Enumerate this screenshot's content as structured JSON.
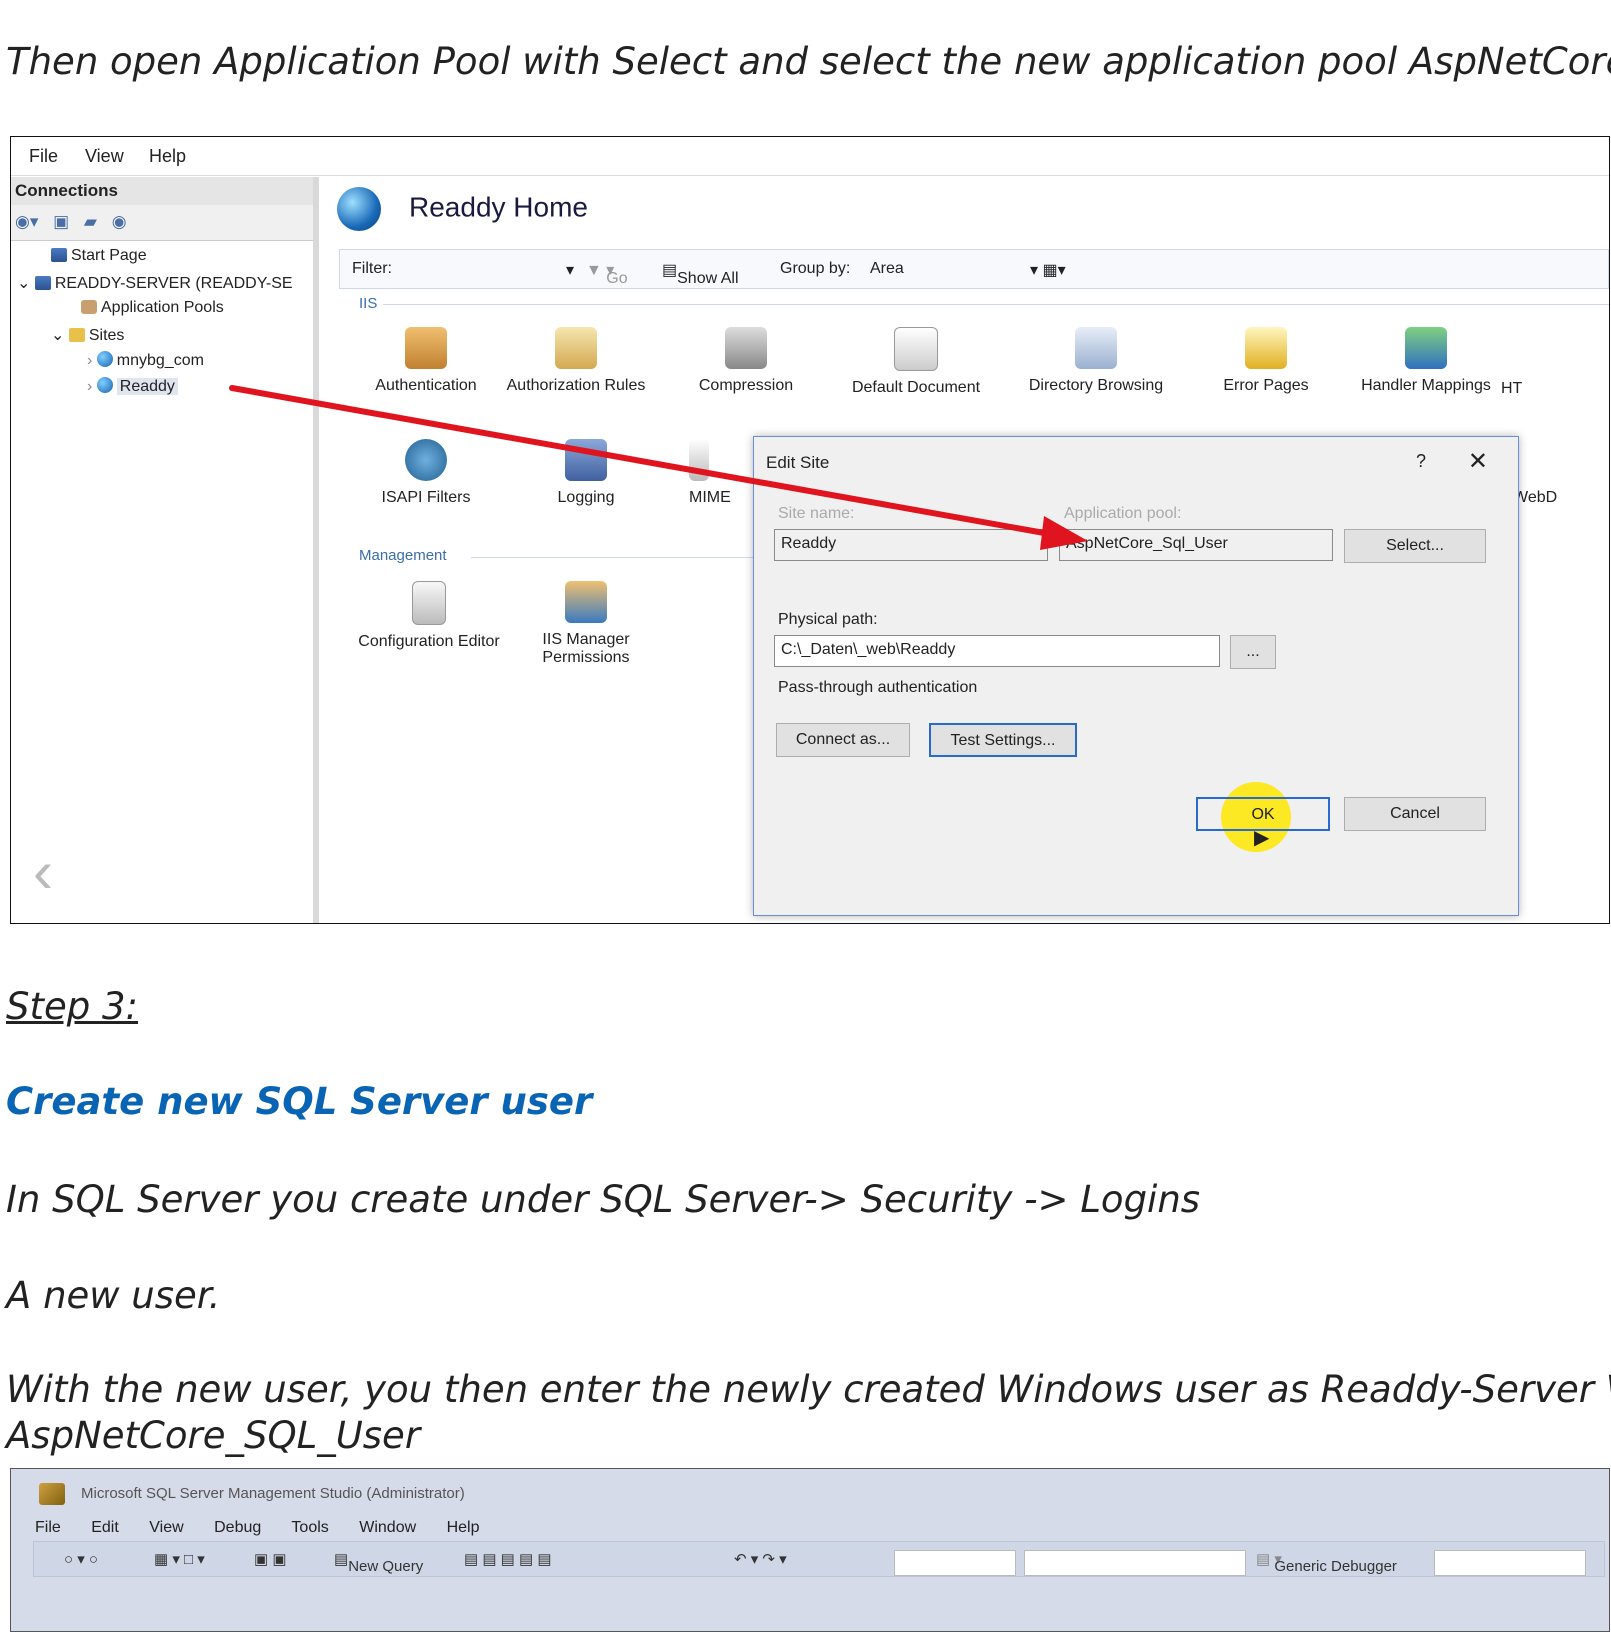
{
  "doc": {
    "intro": "Then open Application Pool with Select and select the new application pool AspNetCore_",
    "step": "Step 3:",
    "heading": "Create new SQL Server user",
    "p1": "In SQL Server you create under SQL Server-> Security -> Logins",
    "p2": "A new user.",
    "p3a": "With the new user, you then enter the newly created Windows user as Readdy-Server \\",
    "p3b": "AspNetCore_SQL_User"
  },
  "iis": {
    "menu": [
      "File",
      "View",
      "Help"
    ],
    "connections": {
      "title": "Connections",
      "tree": {
        "start_page": "Start Page",
        "server": "READDY-SERVER (READDY-SE",
        "app_pools": "Application Pools",
        "sites": "Sites",
        "site1": "mnybg_com",
        "site2": "Readdy"
      }
    },
    "main": {
      "title": "Readdy Home",
      "filter_label": "Filter:",
      "go": "Go",
      "show_all": "Show All",
      "group_by": "Group by:",
      "group_value": "Area",
      "group_iis": "IIS",
      "group_management": "Management",
      "features_iis": [
        "Authentication",
        "Authorization Rules",
        "Compression",
        "Default Document",
        "Directory Browsing",
        "Error Pages",
        "Handler Mappings",
        "HT"
      ],
      "features_iis2": [
        "ISAPI Filters",
        "Logging",
        "MIME"
      ],
      "feature_webd": "WebD",
      "features_mgmt": [
        "Configuration Editor",
        "IIS Manager Permissions"
      ]
    },
    "dialog": {
      "title": "Edit Site",
      "help": "?",
      "close": "✕",
      "site_name_label": "Site name:",
      "site_name_value": "Readdy",
      "app_pool_label": "Application pool:",
      "app_pool_value": "AspNetCore_Sql_User",
      "select_button": "Select...",
      "physical_path_label": "Physical path:",
      "physical_path_value": "C:\\_Daten\\_web\\Readdy",
      "browse_button": "...",
      "pass_through": "Pass-through authentication",
      "connect_as": "Connect as...",
      "test_settings": "Test Settings...",
      "ok": "OK",
      "cancel": "Cancel"
    }
  },
  "ssms": {
    "title": "Microsoft SQL Server Management Studio (Administrator)",
    "menu": [
      "File",
      "Edit",
      "View",
      "Debug",
      "Tools",
      "Window",
      "Help"
    ],
    "new_query": "New Query",
    "generic_debugger": "Generic Debugger"
  },
  "colors": {
    "heading": "#0a64b4",
    "arrow": "#e0141e",
    "highlight": "#ffe600"
  }
}
